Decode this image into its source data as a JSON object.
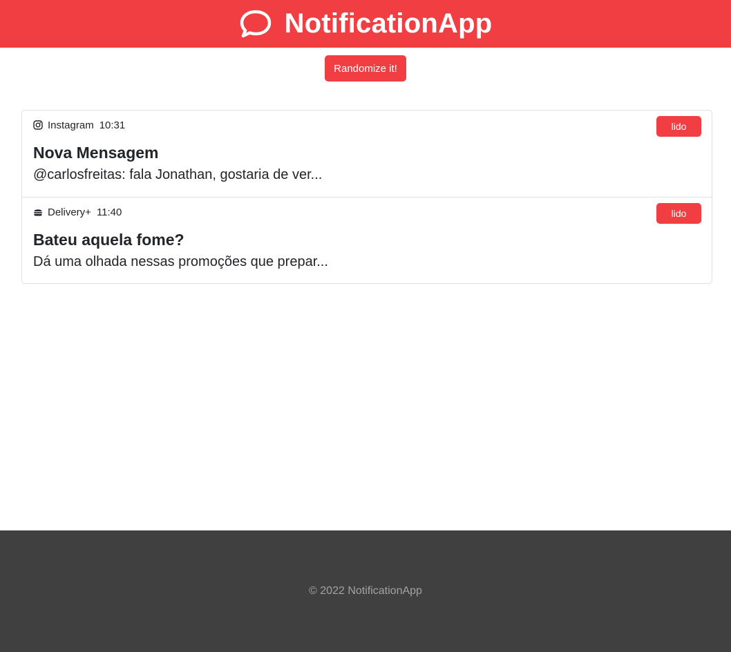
{
  "header": {
    "title": "NotificationApp",
    "icon": "chat-bubble-icon"
  },
  "toolbar": {
    "randomize_label": "Randomize it!"
  },
  "notifications": [
    {
      "app": "Instagram",
      "app_icon": "instagram-icon",
      "time": "10:31",
      "title": "Nova Mensagem",
      "body": "@carlosfreitas: fala Jonathan, gostaria de ver...",
      "read_label": "lido"
    },
    {
      "app": "Delivery+",
      "app_icon": "burger-icon",
      "time": "11:40",
      "title": "Bateu aquela fome?",
      "body": "Dá uma olhada nessas promoções que prepar...",
      "read_label": "lido"
    }
  ],
  "footer": {
    "copyright": "© 2022 NotificationApp"
  },
  "colors": {
    "accent": "#f03e43",
    "footer_bg": "#404040",
    "footer_text": "#a3a3a3"
  }
}
